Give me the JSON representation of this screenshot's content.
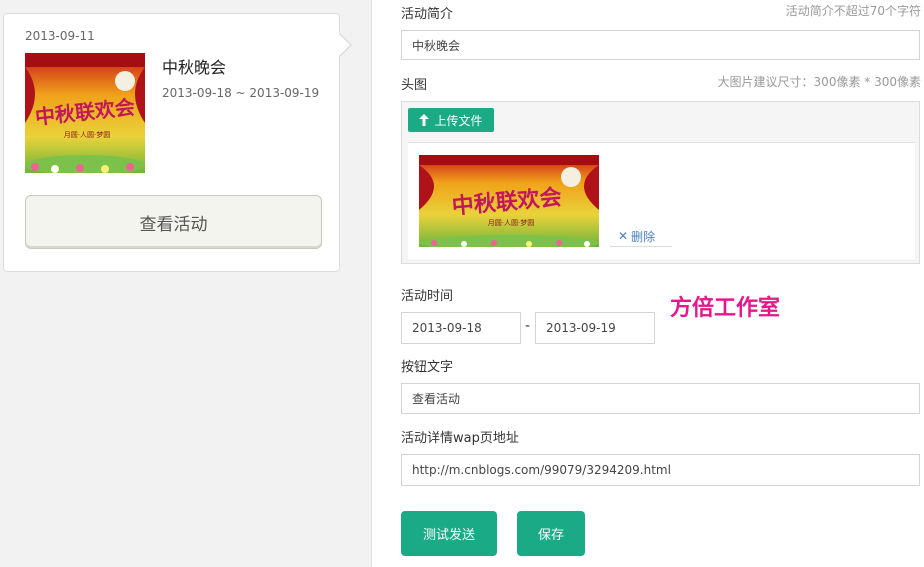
{
  "preview": {
    "date": "2013-09-11",
    "title": "中秋晚会",
    "date_range": "2013-09-18 ~ 2013-09-19",
    "view_button": "查看活动",
    "poster_text": "中秋联欢会",
    "poster_subtext": "月圆·人圆·梦圆"
  },
  "form": {
    "summary": {
      "label": "活动简介",
      "hint": "活动简介不超过70个字符",
      "value": "中秋晚会"
    },
    "header_image": {
      "label": "头图",
      "hint": "大图片建议尺寸：300像素 * 300像素",
      "upload_button": "上传文件",
      "delete_label": "删除"
    },
    "time": {
      "label": "活动时间",
      "start": "2013-09-18",
      "separator": "-",
      "end": "2013-09-19"
    },
    "button_text": {
      "label": "按钮文字",
      "value": "查看活动"
    },
    "wap_url": {
      "label": "活动详情wap页地址",
      "value": "http://m.cnblogs.com/99079/3294209.html"
    }
  },
  "actions": {
    "test_send": "测试发送",
    "save": "保存"
  },
  "watermark": "方倍工作室",
  "colors": {
    "accent": "#1aab86",
    "watermark": "#e6178a",
    "link": "#4a7fc0"
  }
}
